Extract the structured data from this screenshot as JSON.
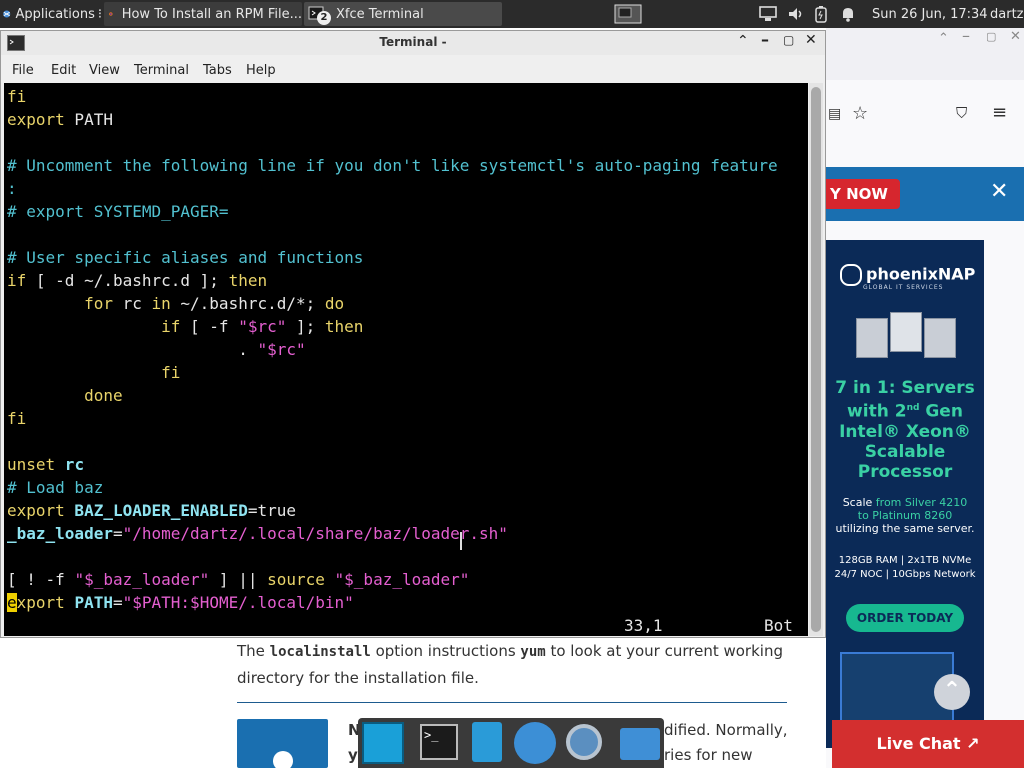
{
  "panel": {
    "applications_label": "Applications",
    "tasks": [
      {
        "label": "How To Install an RPM File...",
        "icon": "firefox-icon"
      },
      {
        "label": "Xfce Terminal",
        "icon": "terminal-icon",
        "badge": "2"
      }
    ],
    "datetime": "Sun 26 Jun, 17:34",
    "user": "dartz"
  },
  "terminal": {
    "title": "Terminal -",
    "menu": [
      "File",
      "Edit",
      "View",
      "Terminal",
      "Tabs",
      "Help"
    ],
    "lines": {
      "l1": "fi",
      "l2a": "export",
      "l2b": " PATH",
      "l4": "# Uncomment the following line if you don't like systemctl's auto-paging feature",
      "l5": ":",
      "l6": "# export SYSTEMD_PAGER=",
      "l8": "# User specific aliases and functions",
      "l9a": "if",
      "l9b": " [ -d ~/.bashrc.d ]; ",
      "l9c": "then",
      "l10a": "        for",
      "l10b": " rc ",
      "l10c": "in",
      "l10d": " ~/.bashrc.d/*; ",
      "l10e": "do",
      "l11a": "                if",
      "l11b": " [ -f ",
      "l11c": "\"$rc\"",
      "l11d": " ]; ",
      "l11e": "then",
      "l12a": "                        . ",
      "l12b": "\"$rc\"",
      "l13": "                fi",
      "l14": "        done",
      "l15": "fi",
      "l17a": "unset",
      "l17b": " rc",
      "l18": "# Load baz",
      "l19a": "export",
      "l19b": " BAZ_LOADER_ENABLED",
      "l19c": "=true",
      "l20a": "_baz_loader",
      "l20b": "=",
      "l20c": "\"/home/dartz/.local/share/baz/loader.sh\"",
      "l22a": "[ ! -f ",
      "l22b": "\"$_baz_loader\"",
      "l22c": " ] || ",
      "l22d": "source",
      "l22e": " ",
      "l22f": "\"$_baz_loader\"",
      "l23cur": "e",
      "l23a": "xport",
      "l23b": " PATH",
      "l23c": "=",
      "l23d": "\"$PATH:$HOME/.local/bin\""
    },
    "status_pos": "33,1",
    "status_where": "Bot"
  },
  "webpage": {
    "para1_pre": "The ",
    "para1_code1": "localinstall",
    "para1_mid": " option instructions ",
    "para1_code2": "yum",
    "para1_post": " to look at your current working",
    "para1_line2": "directory for the installation file.",
    "para2_line1_start": "N",
    "para2_line1_end": "dified. Normally,",
    "para2_line2_start": "y",
    "para2_line2_end": "ries for new"
  },
  "sidebar_ad": {
    "banner_text": "Y NOW",
    "brand": "phoenixNAP",
    "brand_sub": "GLOBAL IT SERVICES",
    "headline1": "7 in 1: Servers",
    "headline2": "with 2",
    "headline2_sup": "nd",
    "headline2_end": " Gen",
    "headline3": "Intel® Xeon®",
    "headline4": "Scalable",
    "headline5": "Processor",
    "scale_pre": "Scale ",
    "scale_from": "from Silver 4210",
    "scale_to": "to Platinum 8260",
    "scale_post": "utilizing the same server.",
    "specs1": "128GB RAM | 2x1TB NVMe",
    "specs2": "24/7 NOC | 10Gbps Network",
    "cta": "ORDER TODAY",
    "live_chat": "Live Chat ↗"
  },
  "colors": {
    "panel_bg": "#2b2b2b",
    "terminal_bg": "#000000",
    "keyword": "#e9d46a",
    "comment": "#52c1d0",
    "string": "#e45fd0",
    "banner_red": "#d6262e",
    "ad_blue": "#1a6fb0",
    "ad_bg": "#0b2a57",
    "cta_green": "#17b890",
    "live_chat_red": "#d32f2f"
  }
}
